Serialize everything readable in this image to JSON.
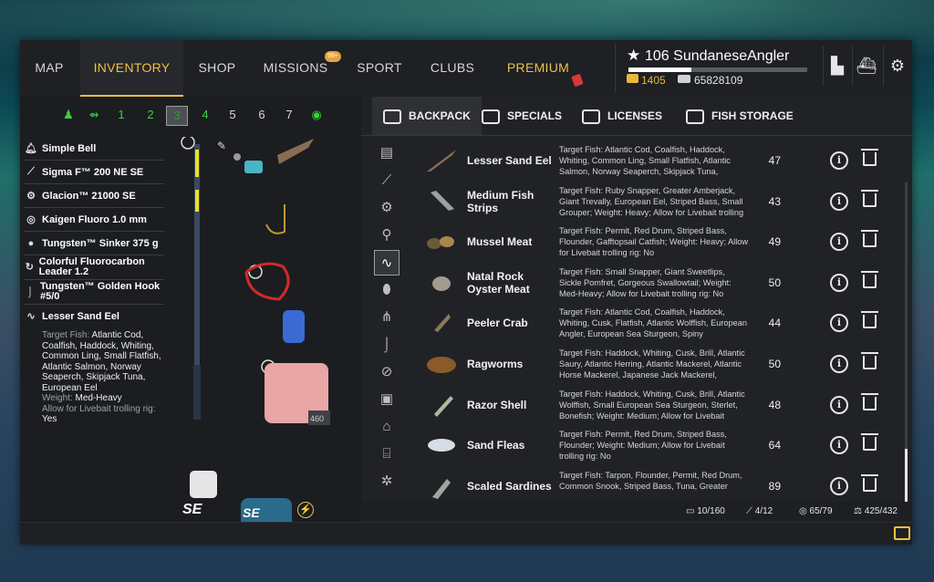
{
  "nav": {
    "tabs": [
      "MAP",
      "INVENTORY",
      "SHOP",
      "MISSIONS",
      "SPORT",
      "CLUBS",
      "PREMIUM"
    ],
    "missions_badge": "99+"
  },
  "profile": {
    "level": "106",
    "name": "SundaneseAngler",
    "gold": "1405",
    "silver": "65828109",
    "xp_fraction": 0.35
  },
  "slots": [
    "1",
    "2",
    "3",
    "4",
    "5",
    "6",
    "7"
  ],
  "gear": [
    {
      "icon": "bell-icon",
      "label": "Simple Bell"
    },
    {
      "icon": "rod-icon",
      "label": "Sigma F™ 200 NE SE"
    },
    {
      "icon": "reel-icon",
      "label": "Glacion™ 21000 SE"
    },
    {
      "icon": "line-icon",
      "label": "Kaigen Fluoro 1.0 mm"
    },
    {
      "icon": "sinker-icon",
      "label": "Tungsten™ Sinker 375 g"
    },
    {
      "icon": "leader-icon",
      "label": "Colorful Fluorocarbon Leader 1.2"
    },
    {
      "icon": "hook-icon",
      "label": "Tungsten™ Golden Hook #5/0"
    },
    {
      "icon": "bait-icon",
      "label": "Lesser Sand Eel"
    }
  ],
  "bait_detail": {
    "target_label": "Target Fish",
    "target_value": "Atlantic Cod, Coalfish, Haddock, Whiting, Common Ling, Small Flatfish, Atlantic Salmon, Norway Seaperch, Skipjack Tuna, European Eel",
    "weight_label": "Weight",
    "weight_value": "Med-Heavy",
    "allow_label": "Allow for Livebait trolling rig",
    "allow_value": "Yes"
  },
  "rig": {
    "line_amount": "460",
    "rod_label": "SE",
    "reel_label": "SE"
  },
  "tabs": [
    "BACKPACK",
    "SPECIALS",
    "LICENSES",
    "FISH STORAGE"
  ],
  "items": [
    {
      "name": "Lesser Sand Eel",
      "desc": "Target Fish: Atlantic Cod, Coalfish, Haddock, Whiting, Common Ling, Small Flatfish, Atlantic Salmon, Norway Seaperch, Skipjack Tuna,",
      "qty": "47"
    },
    {
      "name": "Medium Fish Strips",
      "desc": "Target Fish: Ruby Snapper, Greater Amberjack, Giant Trevally, European Eel, Striped Bass, Small Grouper; Weight: Heavy; Allow for Livebait trolling",
      "qty": "43"
    },
    {
      "name": "Mussel Meat",
      "desc": "Target Fish: Permit, Red Drum, Striped Bass, Flounder, Gafftopsail Catfish; Weight: Heavy; Allow for Livebait trolling rig: No",
      "qty": "49"
    },
    {
      "name": "Natal Rock Oyster Meat",
      "desc": "Target Fish: Small Snapper, Giant Sweetlips, Sickle Pomfret, Gorgeous Swallowtail; Weight: Med-Heavy; Allow for Livebait trolling rig: No",
      "qty": "50"
    },
    {
      "name": "Peeler Crab",
      "desc": "Target Fish: Atlantic Cod, Coalfish, Haddock, Whiting, Cusk, Flatfish, Atlantic Wolffish, European Angler, European Sea Sturgeon, Spiny",
      "qty": "44"
    },
    {
      "name": "Ragworms",
      "desc": "Target Fish: Haddock, Whiting, Cusk, Brill, Atlantic Saury, Atlantic Herring, Atlantic Mackerel, Atlantic Horse Mackerel, Japanese Jack Mackerel,",
      "qty": "50"
    },
    {
      "name": "Razor Shell",
      "desc": "Target Fish: Haddock, Whiting, Cusk, Brill, Atlantic Wolffish, Small European Sea Sturgeon, Sterlet, Bonefish; Weight: Medium; Allow for Livebait",
      "qty": "48"
    },
    {
      "name": "Sand Fleas",
      "desc": "Target Fish: Permit, Red Drum, Striped Bass, Flounder; Weight: Medium; Allow for Livebait trolling rig: No",
      "qty": "64"
    },
    {
      "name": "Scaled Sardines",
      "desc": "Target Fish: Tarpon, Flounder, Permit, Red Drum, Common Snook, Striped Bass, Tuna, Greater",
      "qty": "89"
    }
  ],
  "status": {
    "backpack": "10/160",
    "rods": "4/12",
    "lines": "65/79",
    "weight": "425/432"
  },
  "colors": {
    "accent": "#f0c040",
    "green": "#3bd13b"
  }
}
